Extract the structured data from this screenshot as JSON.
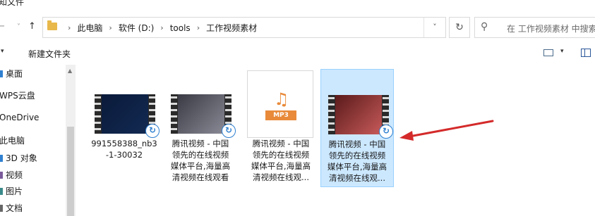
{
  "window": {
    "title_fragment": "知文件"
  },
  "nav": {
    "back": "←",
    "forward": "→",
    "dropdown": "˅",
    "up": "↑"
  },
  "address": {
    "crumbs": [
      "此电脑",
      "软件 (D:)",
      "tools",
      "工作视频素材"
    ],
    "separator": "›",
    "dropdown_glyph": "˅",
    "refresh_glyph": "↻"
  },
  "search": {
    "icon": "⚲",
    "placeholder": "在 工作视频素材 中搜索"
  },
  "toolbar": {
    "new_folder": "新建文件夹",
    "caret": "▾"
  },
  "sidebar": {
    "items": [
      {
        "label": "桌面",
        "color": "#2f80d0"
      },
      {
        "label": "WPS云盘",
        "color": ""
      },
      {
        "label": "OneDrive",
        "color": ""
      },
      {
        "label": "此电脑",
        "color": ""
      },
      {
        "label": "3D 对象",
        "color": "#2f80d0"
      },
      {
        "label": "视频",
        "color": "#7a5a9a"
      },
      {
        "label": "图片",
        "color": "#3a8a8a"
      },
      {
        "label": "文档",
        "color": "#666666"
      }
    ]
  },
  "files": [
    {
      "name": "991558388_nb3\n-1-30032",
      "type": "video",
      "selected": false,
      "scene": [
        "#0a1a3a",
        "#132a52"
      ]
    },
    {
      "name": "腾讯视频 - 中国\n领先的在线视频\n媒体平台,海量高\n清视频在线观看",
      "type": "video",
      "selected": false,
      "scene": [
        "#3a3a44",
        "#8a8a96"
      ]
    },
    {
      "name": "腾讯视频 - 中国\n领先的在线视频\n媒体平台,海量高\n清视频在线观...",
      "type": "mp3",
      "selected": false,
      "label": "MP3"
    },
    {
      "name": "腾讯视频 - 中国\n领先的在线视频\n媒体平台,海量高\n清视频在线观...",
      "type": "video",
      "selected": true,
      "scene": [
        "#5a1a1a",
        "#c85a5a"
      ]
    }
  ],
  "badge_glyph": "↻",
  "note_glyph": "♫",
  "arrow_color": "#d42a2a"
}
